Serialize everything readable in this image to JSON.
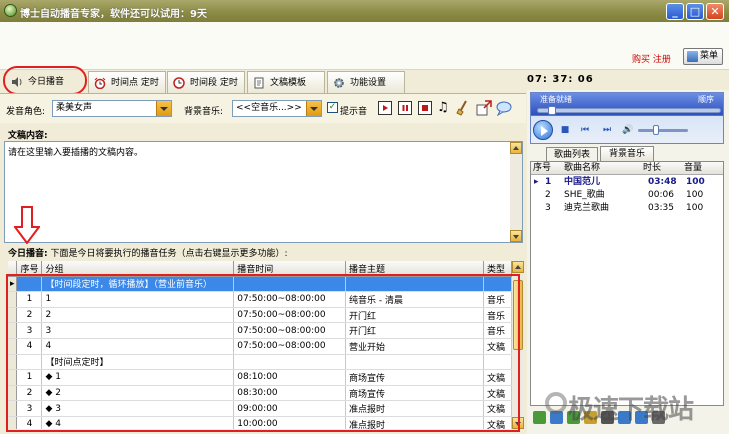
{
  "window": {
    "title": "博士自动播音专家，软件还可以试用：9天"
  },
  "header": {
    "buy_register": "购买 注册",
    "menu_label": "菜单"
  },
  "tabs": [
    {
      "label": "今日播音",
      "icon": "speaker-icon",
      "active": true
    },
    {
      "label": "时间点 定时",
      "icon": "alarm-clock-icon"
    },
    {
      "label": "时间段 定时",
      "icon": "clock-icon"
    },
    {
      "label": "文稿模板",
      "icon": "document-icon"
    },
    {
      "label": "功能设置",
      "icon": "gear-icon"
    }
  ],
  "clock": "07: 37: 06",
  "controls": {
    "voice_label": "发音角色:",
    "voice_value": "柔美女声",
    "bgm_label": "背景音乐:",
    "bgm_value": "<<空音乐...>>",
    "prompt_label": "提示音",
    "prompt_checked": true
  },
  "content": {
    "label": "文稿内容:",
    "placeholder": "请在这里输入要插播的文稿内容。"
  },
  "tasks": {
    "title": "今日播音:",
    "subtitle": "下面是今日将要执行的播音任务（点击右键显示更多功能）:",
    "columns": [
      "序号",
      "分组",
      "播音时间",
      "播音主题",
      "类型"
    ],
    "rows": [
      {
        "seq": "",
        "group": "【时间段定时，循环播放】（营业前音乐）",
        "time": "",
        "topic": "",
        "type": "",
        "selected": true,
        "pointer": true
      },
      {
        "seq": "1",
        "group": "1",
        "time": "07:50:00~08:00:00",
        "topic": "纯音乐 - 清晨",
        "type": "音乐"
      },
      {
        "seq": "2",
        "group": "2",
        "time": "07:50:00~08:00:00",
        "topic": "开门红",
        "type": "音乐"
      },
      {
        "seq": "3",
        "group": "3",
        "time": "07:50:00~08:00:00",
        "topic": "开门红",
        "type": "音乐"
      },
      {
        "seq": "4",
        "group": "4",
        "time": "07:50:00~08:00:00",
        "topic": "营业开始",
        "type": "文稿"
      },
      {
        "seq": "",
        "group": "【时间点定时】",
        "time": "",
        "topic": "",
        "type": ""
      },
      {
        "seq": "1",
        "group": "◆ 1",
        "time": "08:10:00",
        "topic": "商场宣传",
        "type": "文稿"
      },
      {
        "seq": "2",
        "group": "◆ 2",
        "time": "08:30:00",
        "topic": "商场宣传",
        "type": "文稿"
      },
      {
        "seq": "3",
        "group": "◆ 3",
        "time": "09:00:00",
        "topic": "准点报时",
        "type": "文稿"
      },
      {
        "seq": "4",
        "group": "◆ 4",
        "time": "10:00:00",
        "topic": "准点报时",
        "type": "文稿"
      }
    ]
  },
  "player": {
    "status": "准备就绪",
    "order": "顺序",
    "progress": 0.06,
    "volume": 0.3
  },
  "right_tabs": [
    "歌曲列表",
    "背景音乐"
  ],
  "songs": {
    "columns": [
      "序号",
      "歌曲名称",
      "时长",
      "音量"
    ],
    "rows": [
      {
        "seq": "1",
        "name": "中国范儿",
        "duration": "03:48",
        "volume": "100",
        "current": true
      },
      {
        "seq": "2",
        "name": "SHE_歌曲",
        "duration": "00:06",
        "volume": "100"
      },
      {
        "seq": "3",
        "name": "迪克兰歌曲",
        "duration": "03:35",
        "volume": "100"
      }
    ]
  },
  "watermark": "极速下载站",
  "colors": {
    "title_bar": "#8a8a44",
    "selection": "#3b88e8",
    "highlight_ring": "#e02020",
    "buy_text": "#cc0000"
  }
}
